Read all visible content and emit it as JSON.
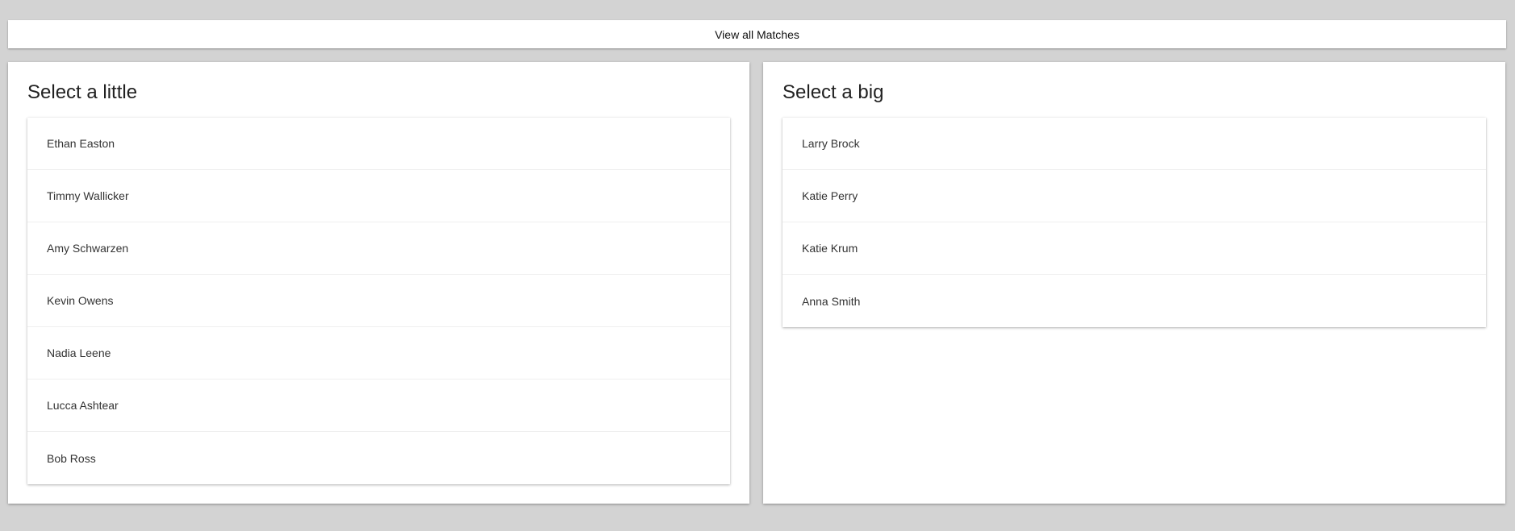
{
  "top_button": {
    "label": "View all Matches"
  },
  "left_panel": {
    "title": "Select a little",
    "items": [
      "Ethan Easton",
      "Timmy Wallicker",
      "Amy Schwarzen",
      "Kevin Owens",
      "Nadia Leene",
      "Lucca Ashtear",
      "Bob Ross"
    ]
  },
  "right_panel": {
    "title": "Select a big",
    "items": [
      "Larry Brock",
      "Katie Perry",
      "Katie Krum",
      "Anna Smith"
    ]
  },
  "colors": {
    "background": "#d3d3d3",
    "card": "#ffffff",
    "text": "#212121"
  }
}
